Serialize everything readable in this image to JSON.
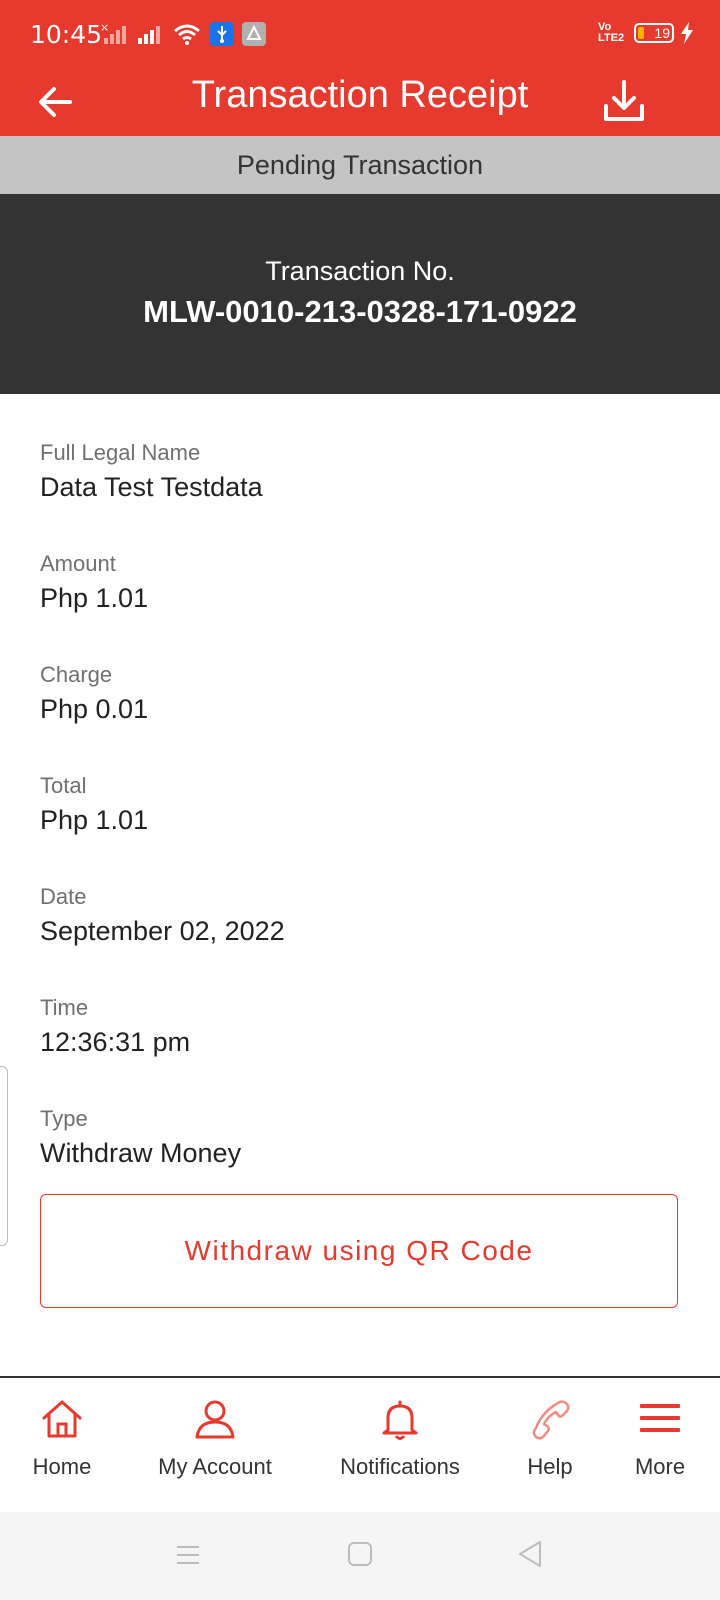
{
  "status_bar": {
    "time": "10:45",
    "battery": "19",
    "network": "Vo LTE2",
    "icons": [
      "no-sim-signal-icon",
      "signal-icon",
      "wifi-icon",
      "usb-icon",
      "app-notification-icon",
      "volte-icon",
      "battery-icon",
      "charging-icon"
    ]
  },
  "header": {
    "title": "Transaction Receipt",
    "back_icon": "arrow-left-icon",
    "download_icon": "download-icon"
  },
  "pending_label": "Pending Transaction",
  "transaction": {
    "label": "Transaction No.",
    "number": "MLW-0010-213-0328-171-0922"
  },
  "details": [
    {
      "label": "Full Legal Name",
      "value": "Data Test Testdata"
    },
    {
      "label": "Amount",
      "value": "Php 1.01"
    },
    {
      "label": "Charge",
      "value": "Php 0.01"
    },
    {
      "label": "Total",
      "value": "Php 1.01"
    },
    {
      "label": "Date",
      "value": "September 02, 2022"
    },
    {
      "label": "Time",
      "value": "12:36:31 pm"
    },
    {
      "label": "Type",
      "value": "Withdraw Money"
    }
  ],
  "action_button": "Withdraw using QR Code",
  "bottom_nav": [
    {
      "label": "Home",
      "icon": "home-icon"
    },
    {
      "label": "My Account",
      "icon": "user-icon"
    },
    {
      "label": "Notifications",
      "icon": "bell-icon"
    },
    {
      "label": "Help",
      "icon": "phone-icon"
    },
    {
      "label": "More",
      "icon": "menu-icon"
    }
  ],
  "colors": {
    "brand_red": "#e63a2e",
    "pending_gray": "#c4c4c4",
    "dark_panel": "#333333"
  }
}
